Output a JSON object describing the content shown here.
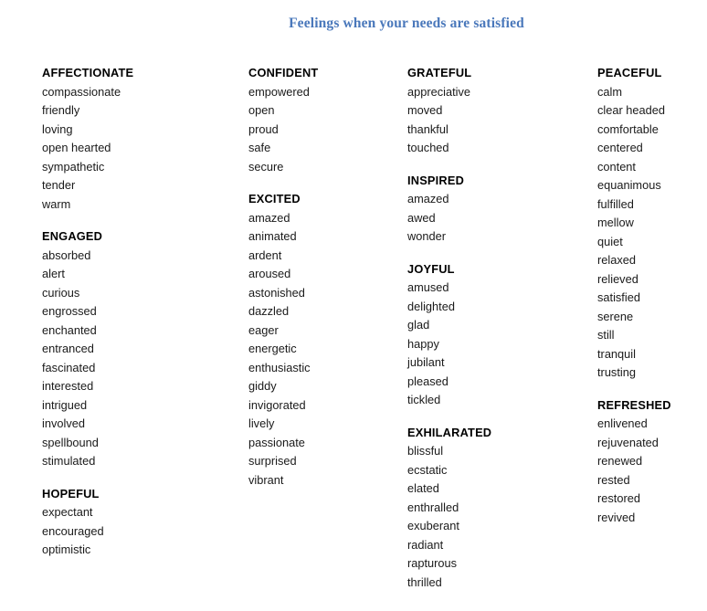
{
  "title": "Feelings when your needs are satisfied",
  "accent_color": "#4a78bb",
  "text_color": "#1a1a1a",
  "background_color": "#ffffff",
  "columns": [
    {
      "id": "column-1",
      "groups": [
        {
          "heading": "AFFECTIONATE",
          "words": [
            "compassionate",
            "friendly",
            "loving",
            "open hearted",
            "sympathetic",
            "tender",
            "warm"
          ]
        },
        {
          "heading": "ENGAGED",
          "words": [
            "absorbed",
            "alert",
            "curious",
            "engrossed",
            "enchanted",
            "entranced",
            "fascinated",
            "interested",
            "intrigued",
            "involved",
            "spellbound",
            "stimulated"
          ]
        },
        {
          "heading": "HOPEFUL",
          "words": [
            "expectant",
            "encouraged",
            "optimistic"
          ]
        }
      ]
    },
    {
      "id": "column-2",
      "groups": [
        {
          "heading": "CONFIDENT",
          "words": [
            "empowered",
            "open",
            "proud",
            "safe",
            "secure"
          ]
        },
        {
          "heading": "EXCITED",
          "words": [
            "amazed",
            "animated",
            "ardent",
            "aroused",
            "astonished",
            "dazzled",
            "eager",
            "energetic",
            "enthusiastic",
            "giddy",
            "invigorated",
            "lively",
            "passionate",
            "surprised",
            "vibrant"
          ]
        }
      ]
    },
    {
      "id": "column-3",
      "groups": [
        {
          "heading": "GRATEFUL",
          "words": [
            "appreciative",
            "moved",
            "thankful",
            "touched"
          ]
        },
        {
          "heading": "INSPIRED",
          "words": [
            "amazed",
            "awed",
            "wonder"
          ]
        },
        {
          "heading": "JOYFUL",
          "words": [
            "amused",
            "delighted",
            "glad",
            "happy",
            "jubilant",
            "pleased",
            "tickled"
          ]
        },
        {
          "heading": "EXHILARATED",
          "words": [
            "blissful",
            "ecstatic",
            "elated",
            "enthralled",
            "exuberant",
            "radiant",
            "rapturous",
            "thrilled"
          ]
        }
      ]
    },
    {
      "id": "column-4",
      "groups": [
        {
          "heading": "PEACEFUL",
          "words": [
            "calm",
            "clear headed",
            "comfortable",
            "centered",
            "content",
            "equanimous",
            "fulfilled",
            "mellow",
            "quiet",
            "relaxed",
            "relieved",
            "satisfied",
            "serene",
            "still",
            "tranquil",
            "trusting"
          ]
        },
        {
          "heading": "REFRESHED",
          "words": [
            "enlivened",
            "rejuvenated",
            "renewed",
            "rested",
            "restored",
            "revived"
          ]
        }
      ]
    }
  ]
}
